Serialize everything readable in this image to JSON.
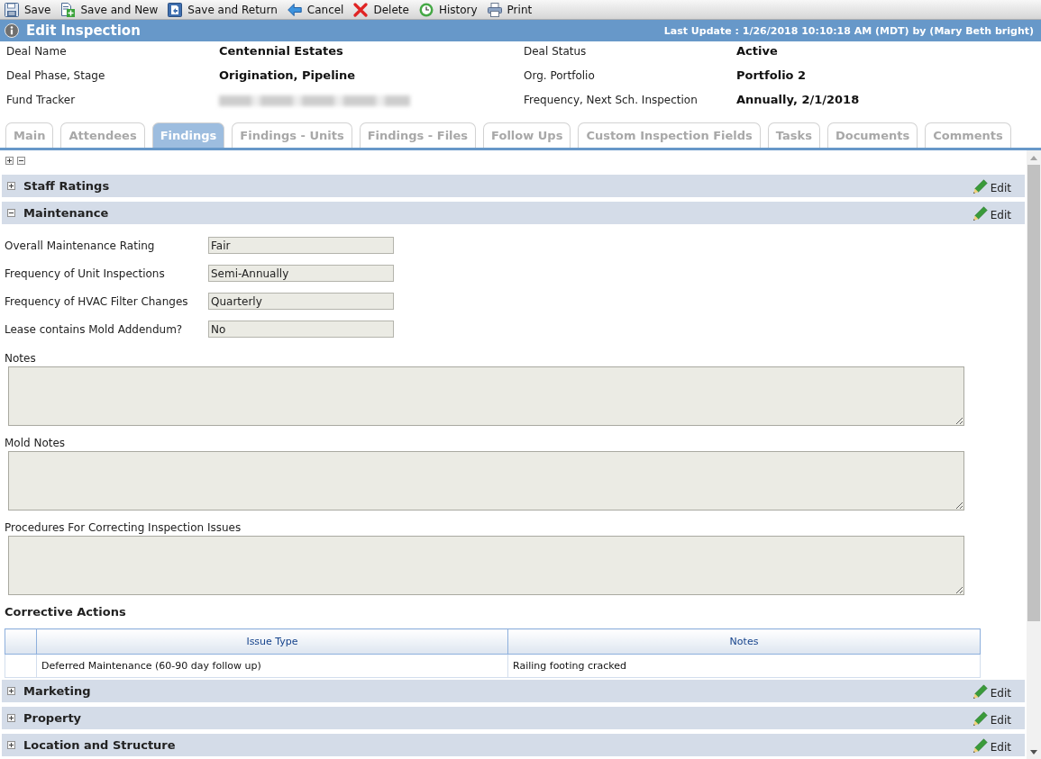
{
  "toolbar": [
    {
      "kind": "save",
      "label": "Save"
    },
    {
      "kind": "new",
      "label": "Save and New"
    },
    {
      "kind": "return",
      "label": "Save and Return"
    },
    {
      "kind": "cancel",
      "label": "Cancel"
    },
    {
      "kind": "delete",
      "label": "Delete"
    },
    {
      "kind": "history",
      "label": "History"
    },
    {
      "kind": "print",
      "label": "Print"
    }
  ],
  "header": {
    "title": "Edit Inspection",
    "last_update": "Last Update : 1/26/2018 10:10:18 AM (MDT) by (Mary Beth bright)"
  },
  "deal_info": [
    {
      "label": "Deal Name",
      "value": "Centennial Estates",
      "redacted": false
    },
    {
      "label": "Deal Status",
      "value": "Active",
      "redacted": false
    },
    {
      "label": "Deal Phase, Stage",
      "value": "Origination, Pipeline",
      "redacted": false
    },
    {
      "label": "Org. Portfolio",
      "value": "Portfolio 2",
      "redacted": false
    },
    {
      "label": "Fund Tracker",
      "redacted": true
    },
    {
      "label": "Frequency, Next Sch. Inspection",
      "value": "Annually, 2/1/2018",
      "redacted": false
    }
  ],
  "tabs": [
    {
      "label": "Main",
      "selected": false
    },
    {
      "label": "Attendees",
      "selected": false
    },
    {
      "label": "Findings",
      "selected": true
    },
    {
      "label": "Findings - Units",
      "selected": false
    },
    {
      "label": "Findings - Files",
      "selected": false
    },
    {
      "label": "Follow Ups",
      "selected": false
    },
    {
      "label": "Custom Inspection Fields",
      "selected": false
    },
    {
      "label": "Tasks",
      "selected": false
    },
    {
      "label": "Documents",
      "selected": false
    },
    {
      "label": "Comments",
      "selected": false
    }
  ],
  "sections": [
    {
      "title": "Staff Ratings",
      "expanded": false,
      "edit_label": "Edit"
    },
    {
      "title": "Maintenance",
      "expanded": true,
      "edit_label": "Edit",
      "fields": [
        {
          "label": "Overall Maintenance Rating",
          "value": "Fair"
        },
        {
          "label": "Frequency of Unit Inspections",
          "value": "Semi-Annually"
        },
        {
          "label": "Frequency of HVAC Filter Changes",
          "value": "Quarterly"
        },
        {
          "label": "Lease contains Mold Addendum?",
          "value": "No"
        }
      ],
      "text_areas": [
        {
          "label": "Notes"
        },
        {
          "label": "Mold Notes"
        },
        {
          "label": "Procedures For Correcting Inspection Issues"
        }
      ],
      "corrective_actions": {
        "title": "Corrective Actions",
        "columns": [
          "Issue Type",
          "Notes"
        ],
        "rows": [
          {
            "cells": [
              "Deferred Maintenance (60-90 day follow up)",
              "Railing footing cracked"
            ]
          }
        ]
      }
    },
    {
      "title": "Marketing",
      "expanded": false,
      "edit_label": "Edit"
    },
    {
      "title": "Property",
      "expanded": false,
      "edit_label": "Edit"
    },
    {
      "title": "Location and Structure",
      "expanded": false,
      "edit_label": "Edit"
    }
  ]
}
